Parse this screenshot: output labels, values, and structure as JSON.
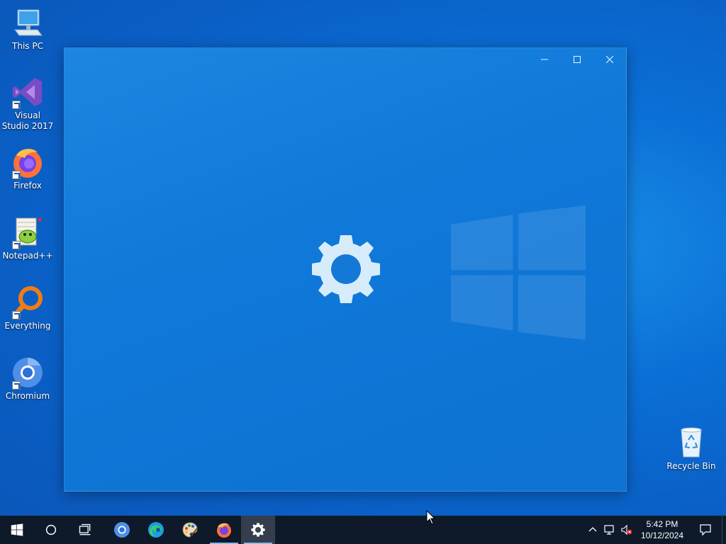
{
  "desktop": {
    "icons": [
      {
        "label": "This PC",
        "icon": "computer-icon"
      },
      {
        "label": "Visual Studio 2017",
        "icon": "visual-studio-icon"
      },
      {
        "label": "Firefox",
        "icon": "firefox-icon"
      },
      {
        "label": "Notepad++",
        "icon": "notepadpp-icon"
      },
      {
        "label": "Everything",
        "icon": "everything-search-icon"
      },
      {
        "label": "Chromium",
        "icon": "chromium-icon"
      },
      {
        "label": "Recycle Bin",
        "icon": "recycle-bin-icon"
      }
    ]
  },
  "window": {
    "app": "Settings",
    "splash_icon": "gear-icon",
    "controls": [
      "minimize",
      "maximize",
      "close"
    ]
  },
  "taskbar": {
    "buttons": [
      {
        "name": "start",
        "icon": "windows-logo-icon"
      },
      {
        "name": "search",
        "icon": "cortana-circle-icon"
      },
      {
        "name": "task-view",
        "icon": "task-view-icon"
      },
      {
        "name": "chromium",
        "icon": "chromium-icon"
      },
      {
        "name": "edge",
        "icon": "edge-icon"
      },
      {
        "name": "paint",
        "icon": "paint-palette-icon"
      },
      {
        "name": "firefox",
        "icon": "firefox-icon",
        "running": true
      },
      {
        "name": "settings",
        "icon": "gear-icon",
        "running": true,
        "active": true
      }
    ],
    "tray": {
      "icons": [
        "chevron-up-icon",
        "network-icon",
        "volume-muted-icon"
      ],
      "time": "5:42 PM",
      "date": "10/12/2024"
    }
  },
  "colors": {
    "desktop_blue": "#0a6fd6",
    "taskbar": "#0e1a2a",
    "window": "#1078d8"
  }
}
